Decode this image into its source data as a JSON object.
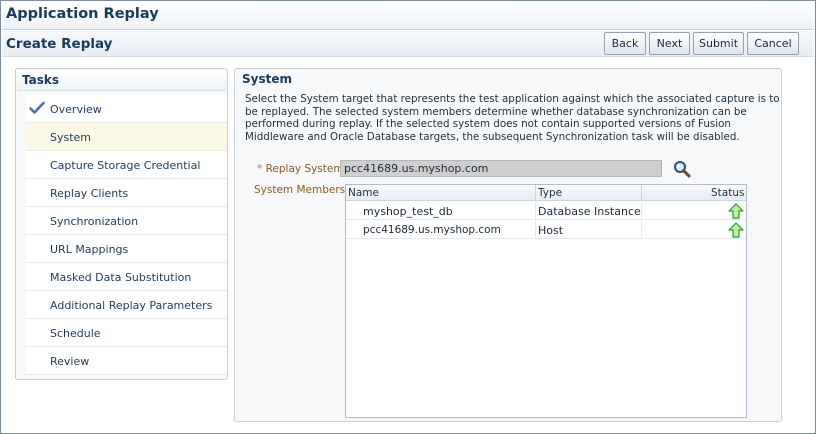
{
  "app": {
    "title": "Application Replay"
  },
  "page": {
    "title": "Create Replay"
  },
  "buttons": {
    "back": "Back",
    "next": "Next",
    "submit": "Submit",
    "cancel": "Cancel"
  },
  "tasks": {
    "title": "Tasks",
    "items": [
      {
        "label": "Overview",
        "status": "complete",
        "icon": "checkmark-icon"
      },
      {
        "label": "System",
        "status": "current"
      },
      {
        "label": "Capture Storage Credential"
      },
      {
        "label": "Replay Clients"
      },
      {
        "label": "Synchronization"
      },
      {
        "label": "URL Mappings"
      },
      {
        "label": "Masked Data Substitution"
      },
      {
        "label": "Additional Replay Parameters"
      },
      {
        "label": "Schedule"
      },
      {
        "label": "Review"
      }
    ]
  },
  "system": {
    "title": "System",
    "description": "Select the System target that represents the test application against which the associated capture is to be replayed. The selected system members determine whether database synchronization can be performed during replay. If the selected system does not contain supported versions of Fusion Middleware and Oracle Database targets, the subsequent Synchronization task will be disabled.",
    "replay_system_label": "Replay System",
    "required_marker": "*",
    "replay_system_value": "pcc41689.us.myshop.com",
    "search_icon": "magnifier-icon",
    "members_label": "System Members",
    "members": {
      "columns": [
        "Name",
        "Type",
        "Status"
      ],
      "rows": [
        {
          "name": "myshop_test_db",
          "type": "Database Instance",
          "status": "up"
        },
        {
          "name": "pcc41689.us.myshop.com",
          "type": "Host",
          "status": "up"
        }
      ]
    }
  },
  "colors": {
    "accent": "#1b3a5a",
    "label": "#8a5a1a",
    "status_up": "#2db52d"
  }
}
